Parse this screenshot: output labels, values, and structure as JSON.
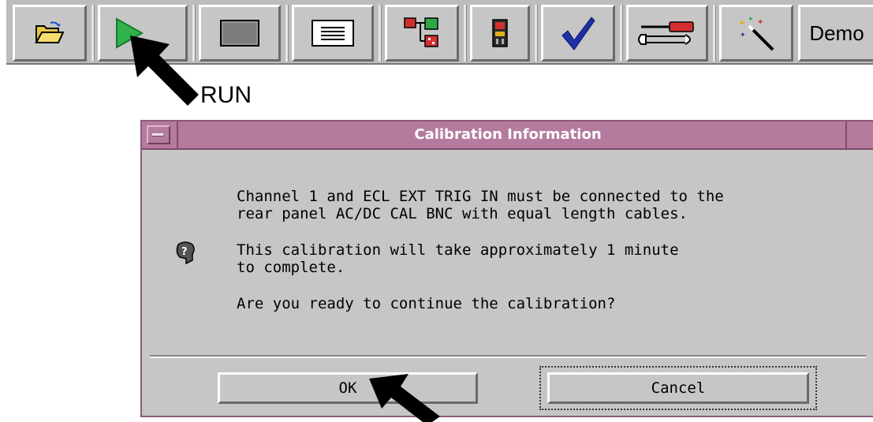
{
  "toolbar": {
    "buttons": [
      {
        "name": "open-folder-button",
        "icon": "open-folder-icon"
      },
      {
        "name": "run-button",
        "icon": "play-icon"
      },
      {
        "name": "stop-button",
        "icon": "stop-icon"
      },
      {
        "name": "listing-button",
        "icon": "listing-icon"
      },
      {
        "name": "system-config-button",
        "icon": "config-tree-icon"
      },
      {
        "name": "module-button",
        "icon": "module-icon"
      },
      {
        "name": "check-button",
        "icon": "checkmark-icon"
      },
      {
        "name": "tools-button",
        "icon": "wrench-screwdriver-icon"
      },
      {
        "name": "wizard-button",
        "icon": "magic-wand-icon"
      }
    ],
    "demo_label": "Demo"
  },
  "annotation": {
    "run_label": "RUN"
  },
  "dialog": {
    "title": "Calibration Information",
    "message_line1": "Channel 1 and ECL EXT TRIG IN must be connected to the",
    "message_line2": "rear panel AC/DC CAL BNC with equal length cables.",
    "message_line3": "This calibration will take approximately 1 minute",
    "message_line4": "to complete.",
    "message_line5": "Are you ready to continue the calibration?",
    "ok_label": "OK",
    "cancel_label": "Cancel"
  },
  "colors": {
    "titlebar": "#b47b9e",
    "dialog_bg": "#c6c6c6",
    "toolbar_bg": "#bdbdbd",
    "play_green": "#2fb34a",
    "check_blue": "#1e2fa8"
  }
}
